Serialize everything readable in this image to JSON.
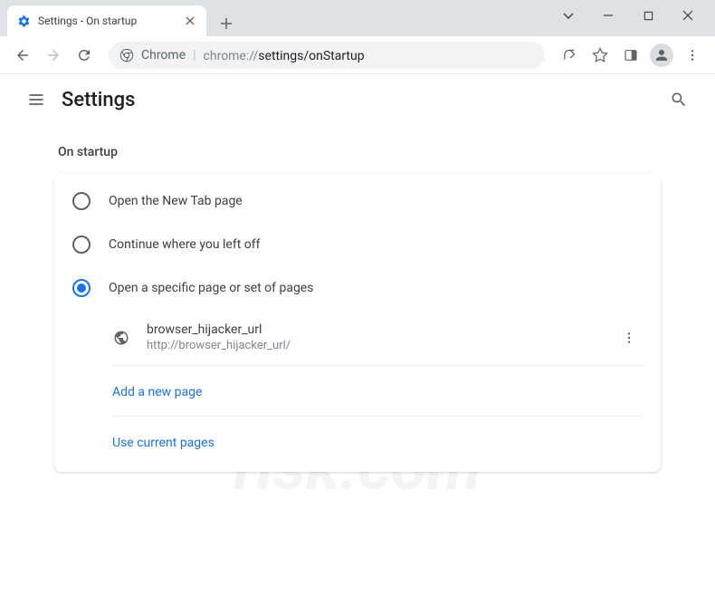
{
  "window": {
    "tab_title": "Settings - On startup"
  },
  "toolbar": {
    "omnibox_prefix": "Chrome",
    "omnibox_path_1": "chrome://",
    "omnibox_path_2": "settings/onStartup"
  },
  "header": {
    "title": "Settings"
  },
  "section": {
    "title": "On startup"
  },
  "options": {
    "opt1": "Open the New Tab page",
    "opt2": "Continue where you left off",
    "opt3": "Open a specific page or set of pages"
  },
  "pages": [
    {
      "name": "browser_hijacker_url",
      "url": "http://browser_hijacker_url/"
    }
  ],
  "links": {
    "add": "Add a new page",
    "use_current": "Use current pages"
  },
  "watermark": {
    "text": "risk.com"
  }
}
